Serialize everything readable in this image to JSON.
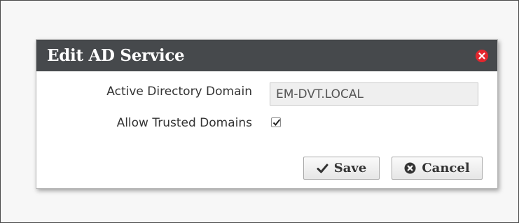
{
  "dialog": {
    "title": "Edit AD Service",
    "close_icon": "close-icon"
  },
  "form": {
    "domain_label": "Active Directory Domain",
    "domain_value": "EM-DVT.LOCAL",
    "trusted_label": "Allow Trusted Domains",
    "trusted_checked": true
  },
  "buttons": {
    "save_label": "Save",
    "save_icon": "checkmark-icon",
    "cancel_label": "Cancel",
    "cancel_icon": "x-circle-icon"
  },
  "colors": {
    "titlebar": "#46494c",
    "close": "#e3262d"
  }
}
